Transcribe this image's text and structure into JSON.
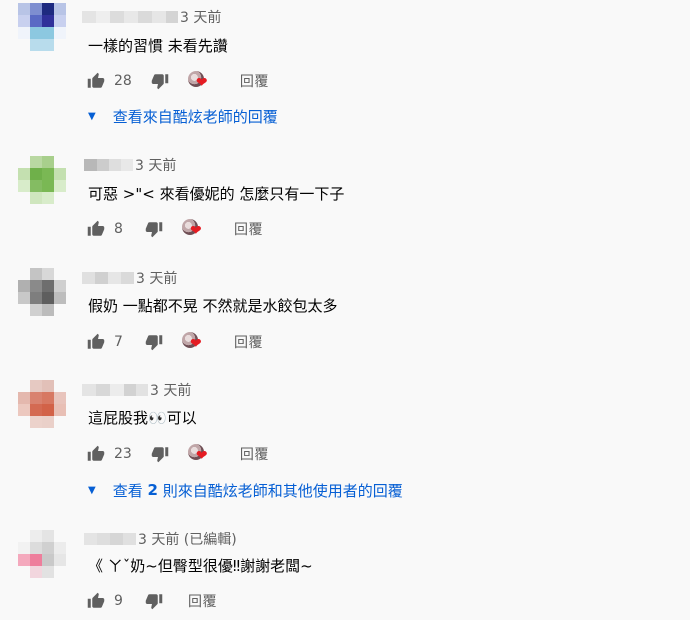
{
  "comments": [
    {
      "timestamp": "3 天前",
      "text": "一樣的習慣 未看先讚",
      "likes": "28",
      "reply_label": "回覆",
      "view_replies": "查看來自酷炫老師的回覆"
    },
    {
      "timestamp": "3 天前",
      "text": "可惡 >\"< 來看優妮的 怎麼只有一下子",
      "likes": "8",
      "reply_label": "回覆"
    },
    {
      "timestamp": "3 天前",
      "text": "假奶 一點都不晃 不然就是水餃包太多",
      "likes": "7",
      "reply_label": "回覆"
    },
    {
      "timestamp": "3 天前",
      "text": "這屁股我👀可以",
      "likes": "23",
      "reply_label": "回覆",
      "view_replies_prefix": "查看 ",
      "view_replies_count": "2",
      "view_replies_suffix": " 則來自酷炫老師和其他使用者的回覆"
    },
    {
      "timestamp": "3 天前 (已編輯)",
      "text": "《 ㄚˇ奶~但臀型很優‼謝謝老闆~",
      "likes": "9",
      "reply_label": "回覆"
    }
  ],
  "colors": {
    "background": "#f9f9f9",
    "meta_text": "#606060",
    "body_text": "#030303",
    "link": "#065fd4",
    "heart": "#e51c23"
  },
  "icons": {
    "like": "thumbs-up-icon",
    "dislike": "thumbs-down-icon",
    "creator_heart": "creator-heart-icon",
    "expand": "caret-down-icon"
  }
}
